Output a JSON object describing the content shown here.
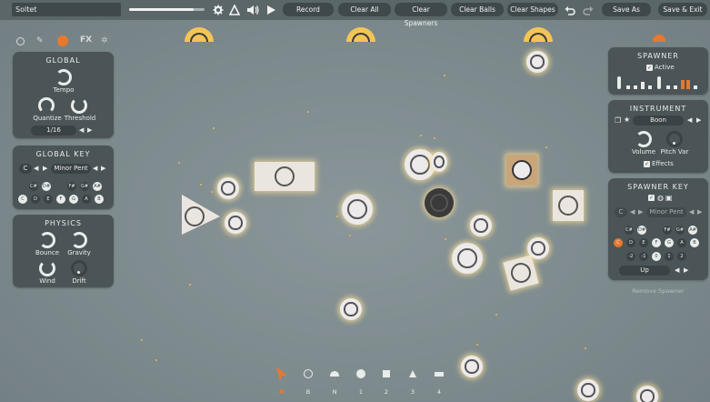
{
  "toolbar": {
    "title": "Soltet",
    "volume_level": 0.85,
    "record": "Record",
    "clear_all": "Clear All",
    "clear_spawners": "Clear Spawners",
    "clear_balls": "Clear Balls",
    "clear_shapes": "Clear Shapes",
    "save_as": "Save As",
    "save_exit": "Save & Exit"
  },
  "left_tabs": [
    "circle-icon",
    "trumpet-icon",
    "smiley-icon",
    "FX",
    "gear-icon"
  ],
  "left_tab_fx": "FX",
  "global": {
    "title": "GLOBAL",
    "tempo": "Tempo",
    "quantize": "Quantize",
    "threshold": "Threshold",
    "division": "1/16"
  },
  "global_key": {
    "title": "GLOBAL KEY",
    "root": "C",
    "scale": "Minor Pent",
    "notes_top": [
      "C#",
      "D#",
      "F#",
      "G#",
      "A#"
    ],
    "notes_bottom": [
      "C",
      "D",
      "E",
      "F",
      "G",
      "A",
      "B"
    ]
  },
  "physics": {
    "title": "PHYSICS",
    "bounce": "Bounce",
    "gravity": "Gravity",
    "wind": "Wind",
    "drift": "Drift"
  },
  "spawner": {
    "title": "SPAWNER",
    "active": "Active",
    "checked": "✓"
  },
  "instrument": {
    "title": "INSTRUMENT",
    "name": "Boon",
    "volume": "Volume",
    "pitch_var": "Pitch Var",
    "effects": "Effects"
  },
  "spawner_key": {
    "title": "SPAWNER KEY",
    "root": "C",
    "scale": "Minor Pent",
    "notes_top": [
      "C#",
      "D#",
      "F#",
      "G#",
      "A#"
    ],
    "notes_mid": [
      "C",
      "D",
      "E",
      "F",
      "G",
      "A",
      "B"
    ],
    "octaves": [
      "-2",
      "-1",
      "0",
      "1",
      "2"
    ],
    "direction": "Up"
  },
  "remove_spawner": "Remove Spawner",
  "bottom_tools": [
    "B",
    "N",
    "1",
    "2",
    "3",
    "4"
  ],
  "colors": {
    "accent": "#e8782c",
    "dome": "#f2c556",
    "panel": "#4b5558"
  }
}
